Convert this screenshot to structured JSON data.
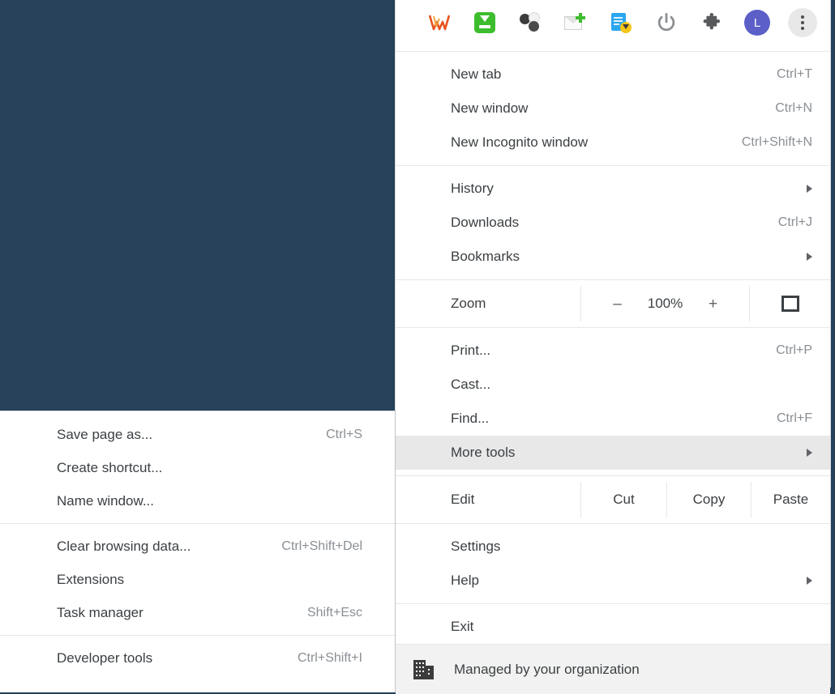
{
  "colors": {
    "page_background": "#28415a",
    "menu_background": "#ffffff",
    "highlight": "#e8e8e8",
    "footer_background": "#f2f2f2",
    "text": "#3c4043",
    "accel_text": "#8a8f94",
    "avatar": "#5b5fc7",
    "download_green": "#3dbd2e",
    "doc_blue": "#2ba7f0",
    "badge_yellow": "#f5c518"
  },
  "toolbar": {
    "icons": [
      {
        "name": "vivaldi-logo-icon",
        "label": "V"
      },
      {
        "name": "download-manager-icon",
        "label": ""
      },
      {
        "name": "molecule-extension-icon",
        "label": ""
      },
      {
        "name": "new-mail-extension-icon",
        "label": ""
      },
      {
        "name": "document-download-icon",
        "label": ""
      },
      {
        "name": "power-extension-icon",
        "label": ""
      },
      {
        "name": "extensions-puzzle-icon",
        "label": ""
      },
      {
        "name": "profile-avatar",
        "label": "L"
      },
      {
        "name": "chrome-menu-kebab-icon",
        "label": ""
      }
    ]
  },
  "main_menu": {
    "groups": [
      {
        "items": [
          {
            "label": "New tab",
            "accel": "Ctrl+T",
            "arrow": false,
            "highlight": false
          },
          {
            "label": "New window",
            "accel": "Ctrl+N",
            "arrow": false,
            "highlight": false
          },
          {
            "label": "New Incognito window",
            "accel": "Ctrl+Shift+N",
            "arrow": false,
            "highlight": false
          }
        ]
      },
      {
        "items": [
          {
            "label": "History",
            "accel": "",
            "arrow": true,
            "highlight": false
          },
          {
            "label": "Downloads",
            "accel": "Ctrl+J",
            "arrow": false,
            "highlight": false
          },
          {
            "label": "Bookmarks",
            "accel": "",
            "arrow": true,
            "highlight": false
          }
        ]
      }
    ],
    "zoom_row": {
      "label": "Zoom",
      "minus": "–",
      "percent": "100%",
      "plus": "+",
      "fullscreen_icon": "fullscreen-icon"
    },
    "tools_group": [
      {
        "label": "Print...",
        "accel": "Ctrl+P",
        "arrow": false,
        "highlight": false
      },
      {
        "label": "Cast...",
        "accel": "",
        "arrow": false,
        "highlight": false
      },
      {
        "label": "Find...",
        "accel": "Ctrl+F",
        "arrow": false,
        "highlight": false
      },
      {
        "label": "More tools",
        "accel": "",
        "arrow": true,
        "highlight": true
      }
    ],
    "edit_row": {
      "label": "Edit",
      "cut": "Cut",
      "copy": "Copy",
      "paste": "Paste"
    },
    "settings_group": [
      {
        "label": "Settings",
        "accel": "",
        "arrow": false,
        "highlight": false
      },
      {
        "label": "Help",
        "accel": "",
        "arrow": true,
        "highlight": false
      }
    ],
    "exit_group": [
      {
        "label": "Exit",
        "accel": "",
        "arrow": false,
        "highlight": false
      }
    ],
    "managed_footer": {
      "icon": "organization-building-icon",
      "label": "Managed by your organization"
    }
  },
  "sub_menu": {
    "groups": [
      {
        "items": [
          {
            "label": "Save page as...",
            "accel": "Ctrl+S",
            "arrow": false,
            "highlight": false
          },
          {
            "label": "Create shortcut...",
            "accel": "",
            "arrow": false,
            "highlight": false
          },
          {
            "label": "Name window...",
            "accel": "",
            "arrow": false,
            "highlight": false
          }
        ]
      },
      {
        "items": [
          {
            "label": "Clear browsing data...",
            "accel": "Ctrl+Shift+Del",
            "arrow": false,
            "highlight": false
          },
          {
            "label": "Extensions",
            "accel": "",
            "arrow": false,
            "highlight": false
          },
          {
            "label": "Task manager",
            "accel": "Shift+Esc",
            "arrow": false,
            "highlight": false
          }
        ]
      },
      {
        "items": [
          {
            "label": "Developer tools",
            "accel": "Ctrl+Shift+I",
            "arrow": false,
            "highlight": false
          }
        ]
      }
    ]
  }
}
